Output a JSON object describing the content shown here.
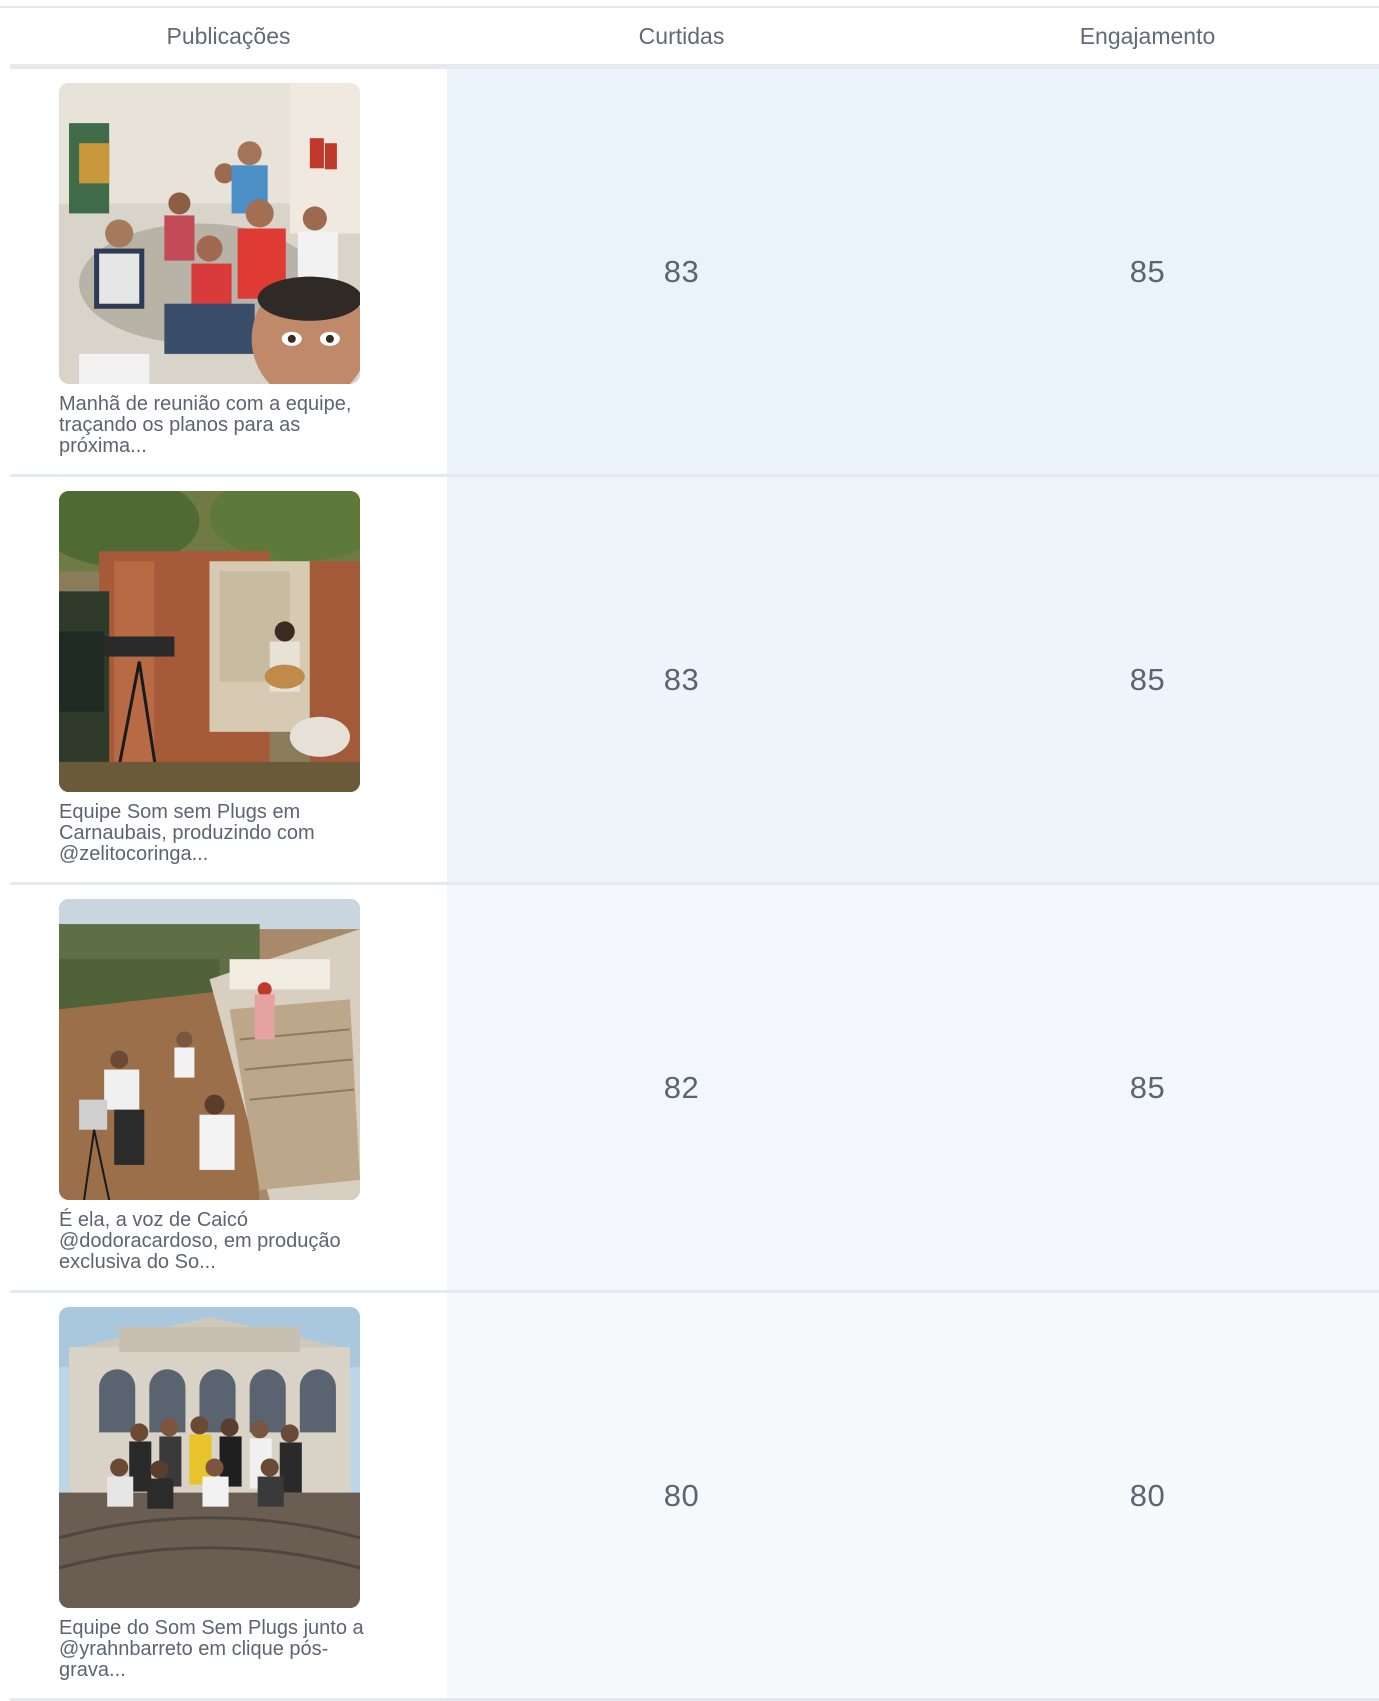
{
  "table": {
    "headers": {
      "publications": "Publicações",
      "likes": "Curtidas",
      "engagement": "Engajamento"
    },
    "rows": [
      {
        "caption": "Manhã de reunião com a equipe, traçando os planos para as próxima...",
        "likes": "83",
        "engagement": "85",
        "image": "team-meeting-selfie-photo"
      },
      {
        "caption": "Equipe Som sem Plugs em Carnaubais, produzindo com @zelitocoringa...",
        "likes": "83",
        "engagement": "85",
        "image": "brick-ruins-filming-photo"
      },
      {
        "caption": "É ela, a voz de Caicó @dodoracardoso, em produção exclusiva do So...",
        "likes": "82",
        "engagement": "85",
        "image": "hillside-stairs-production-photo"
      },
      {
        "caption": "Equipe do Som Sem Plugs junto a @yrahnbarreto em clique pós-grava...",
        "likes": "80",
        "engagement": "80",
        "image": "old-building-group-photo"
      }
    ]
  }
}
